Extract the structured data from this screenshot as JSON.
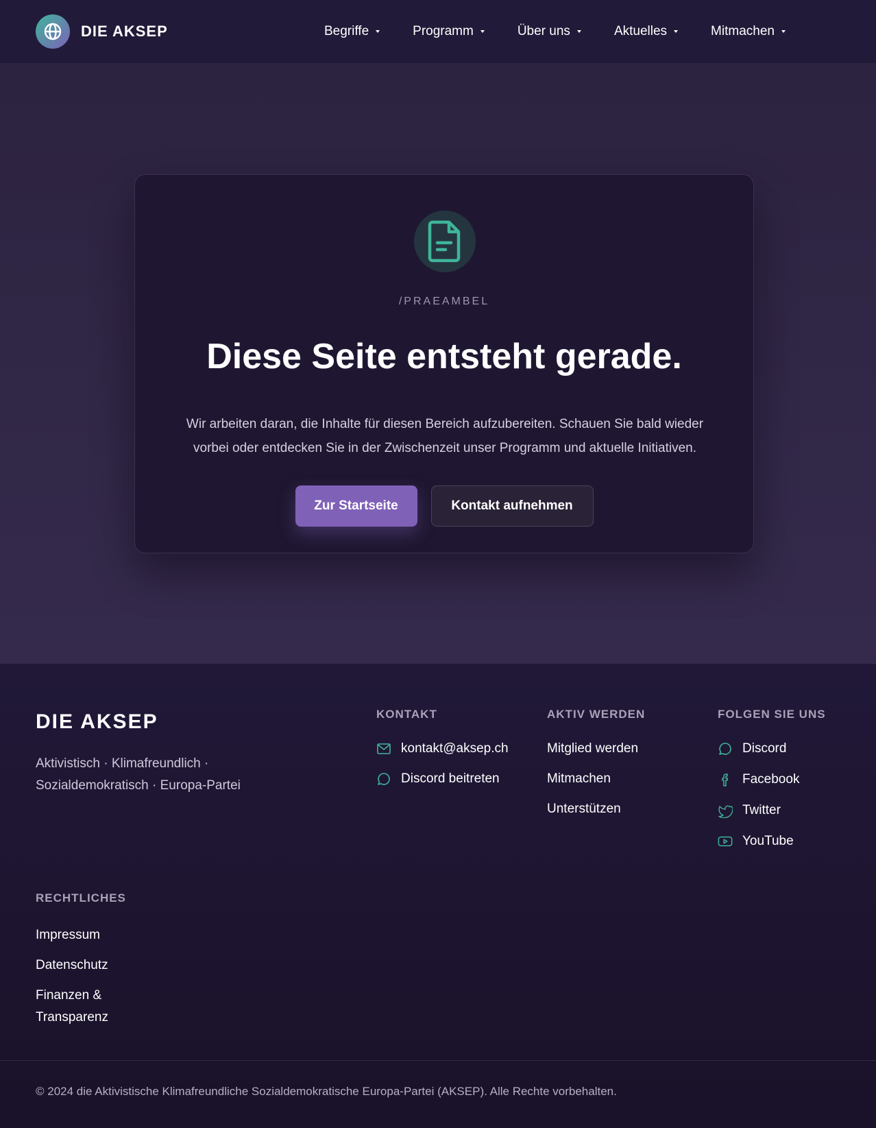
{
  "brand": {
    "name": "DIE AKSEP",
    "accent": "#3fb59a",
    "primary": "#8061b8"
  },
  "nav": {
    "items": [
      {
        "label": "Begriffe"
      },
      {
        "label": "Programm"
      },
      {
        "label": "Über uns"
      },
      {
        "label": "Aktuelles"
      },
      {
        "label": "Mitmachen"
      }
    ]
  },
  "card": {
    "icon": "document-icon",
    "route": "/PRAEAMBEL",
    "title": "Diese Seite entsteht gerade.",
    "text": "Wir arbeiten daran, die Inhalte für diesen Bereich aufzubereiten. Schauen Sie bald wieder vorbei oder entdecken Sie in der Zwischenzeit unser Programm und aktuelle Initiativen.",
    "primary_button": "Zur Startseite",
    "secondary_button": "Kontakt aufnehmen"
  },
  "footer": {
    "brand": "DIE AKSEP",
    "tagline": "Aktivistisch · Klimafreundlich · Sozialdemokratisch · Europa-Partei",
    "kontakt": {
      "heading": "KONTAKT",
      "items": [
        {
          "label": "kontakt@aksep.ch",
          "icon": "mail-icon"
        },
        {
          "label": "Discord beitreten",
          "icon": "chat-icon"
        }
      ]
    },
    "aktiv": {
      "heading": "AKTIV WERDEN",
      "items": [
        {
          "label": "Mitglied werden"
        },
        {
          "label": "Mitmachen"
        },
        {
          "label": "Unterstützen"
        }
      ]
    },
    "folgen": {
      "heading": "FOLGEN SIE UNS",
      "items": [
        {
          "label": "Discord",
          "icon": "discord-icon"
        },
        {
          "label": "Facebook",
          "icon": "facebook-icon"
        },
        {
          "label": "Twitter",
          "icon": "twitter-icon"
        },
        {
          "label": "YouTube",
          "icon": "youtube-icon"
        }
      ]
    },
    "legal": {
      "heading": "RECHTLICHES",
      "items": [
        {
          "label": "Impressum"
        },
        {
          "label": "Datenschutz"
        },
        {
          "label": "Finanzen & Transparenz"
        }
      ]
    },
    "copyright": "© 2024 die Aktivistische Klimafreundliche Sozialdemokratische Europa-Partei (AKSEP). Alle Rechte vorbehalten."
  }
}
